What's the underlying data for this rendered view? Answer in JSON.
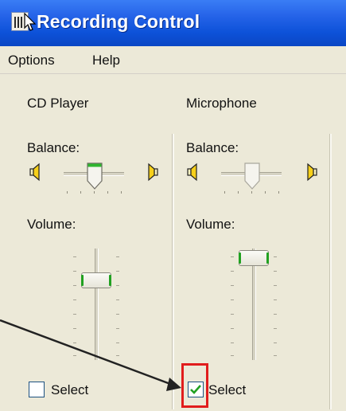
{
  "window": {
    "title": "Recording Control"
  },
  "menu": {
    "items": [
      "Options",
      "Help"
    ]
  },
  "colors": {
    "title_bar": "#0d52d9",
    "checkmark": "#21a121",
    "highlight": "#e11d1d"
  },
  "channels": [
    {
      "name": "CD Player",
      "balance_label": "Balance:",
      "balance_position": 0.5,
      "volume_label": "Volume:",
      "volume_level": 0.7,
      "select_label": "Select",
      "selected": false
    },
    {
      "name": "Microphone",
      "balance_label": "Balance:",
      "balance_position": 0.5,
      "volume_label": "Volume:",
      "volume_level": 0.92,
      "select_label": "Select",
      "selected": true
    }
  ]
}
